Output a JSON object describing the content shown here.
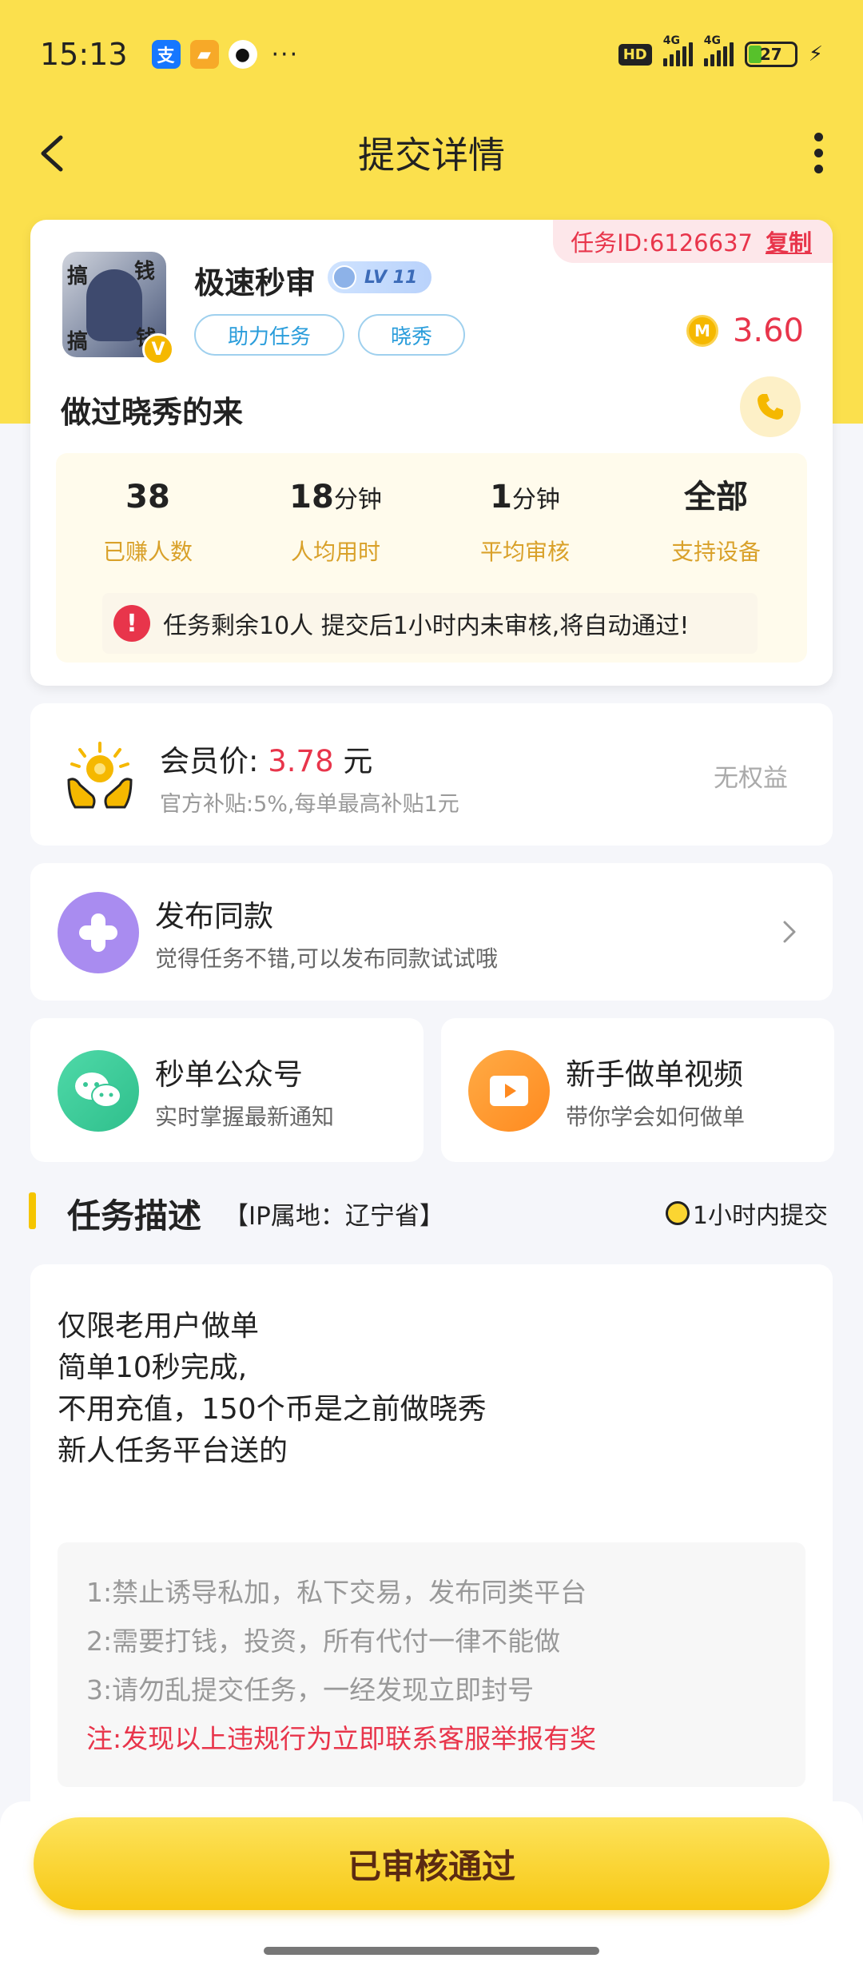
{
  "status_bar": {
    "time": "15:13",
    "app_icons": [
      "alipay-icon",
      "notes-app-icon",
      "qq-icon"
    ],
    "more": "···",
    "hd": "HD",
    "network_1": "4G",
    "network_2": "4G",
    "battery": "27"
  },
  "nav": {
    "title": "提交详情"
  },
  "task": {
    "id_label": "任务ID:6126637",
    "copy_label": "复制",
    "name": "极速秒审",
    "level": "LV 11",
    "tags": [
      "助力任务",
      "晓秀"
    ],
    "price": "3.60",
    "subtitle": "做过晓秀的来",
    "stats": [
      {
        "value": "38",
        "unit": "",
        "label": "已赚人数"
      },
      {
        "value": "18",
        "unit": "分钟",
        "label": "人均用时"
      },
      {
        "value": "1",
        "unit": "分钟",
        "label": "平均审核"
      },
      {
        "value": "全部",
        "unit": "",
        "label": "支持设备"
      }
    ],
    "notice": "任务剩余10人  提交后1小时内未审核,将自动通过!"
  },
  "member": {
    "label": "会员价:",
    "price": "3.78",
    "unit": "元",
    "sub": "官方补贴:5%,每单最高补贴1元",
    "right": "无权益"
  },
  "publish": {
    "title": "发布同款",
    "sub": "觉得任务不错,可以发布同款试试哦"
  },
  "wechat": {
    "title": "秒单公众号",
    "sub": "实时掌握最新通知"
  },
  "video": {
    "title": "新手做单视频",
    "sub": "带你学会如何做单"
  },
  "section": {
    "title": "任务描述",
    "ip": "【IP属地：辽宁省】",
    "deadline": "1小时内提交"
  },
  "description": {
    "lines": [
      "仅限老用户做单",
      "简单10秒完成,",
      "不用充值，150个币是之前做晓秀",
      "新人任务平台送的"
    ],
    "rules": [
      "1:禁止诱导私加，私下交易，发布同类平台",
      "2:需要打钱，投资，所有代付一律不能做",
      "3:请勿乱提交任务，一经发现立即封号"
    ],
    "warning": "注:发现以上违规行为立即联系客服举报有奖"
  },
  "bottom": {
    "button": "已审核通过"
  },
  "colors": {
    "brand_yellow": "#fbe04d",
    "price_red": "#e8354b",
    "stat_label": "#d9a12a"
  }
}
